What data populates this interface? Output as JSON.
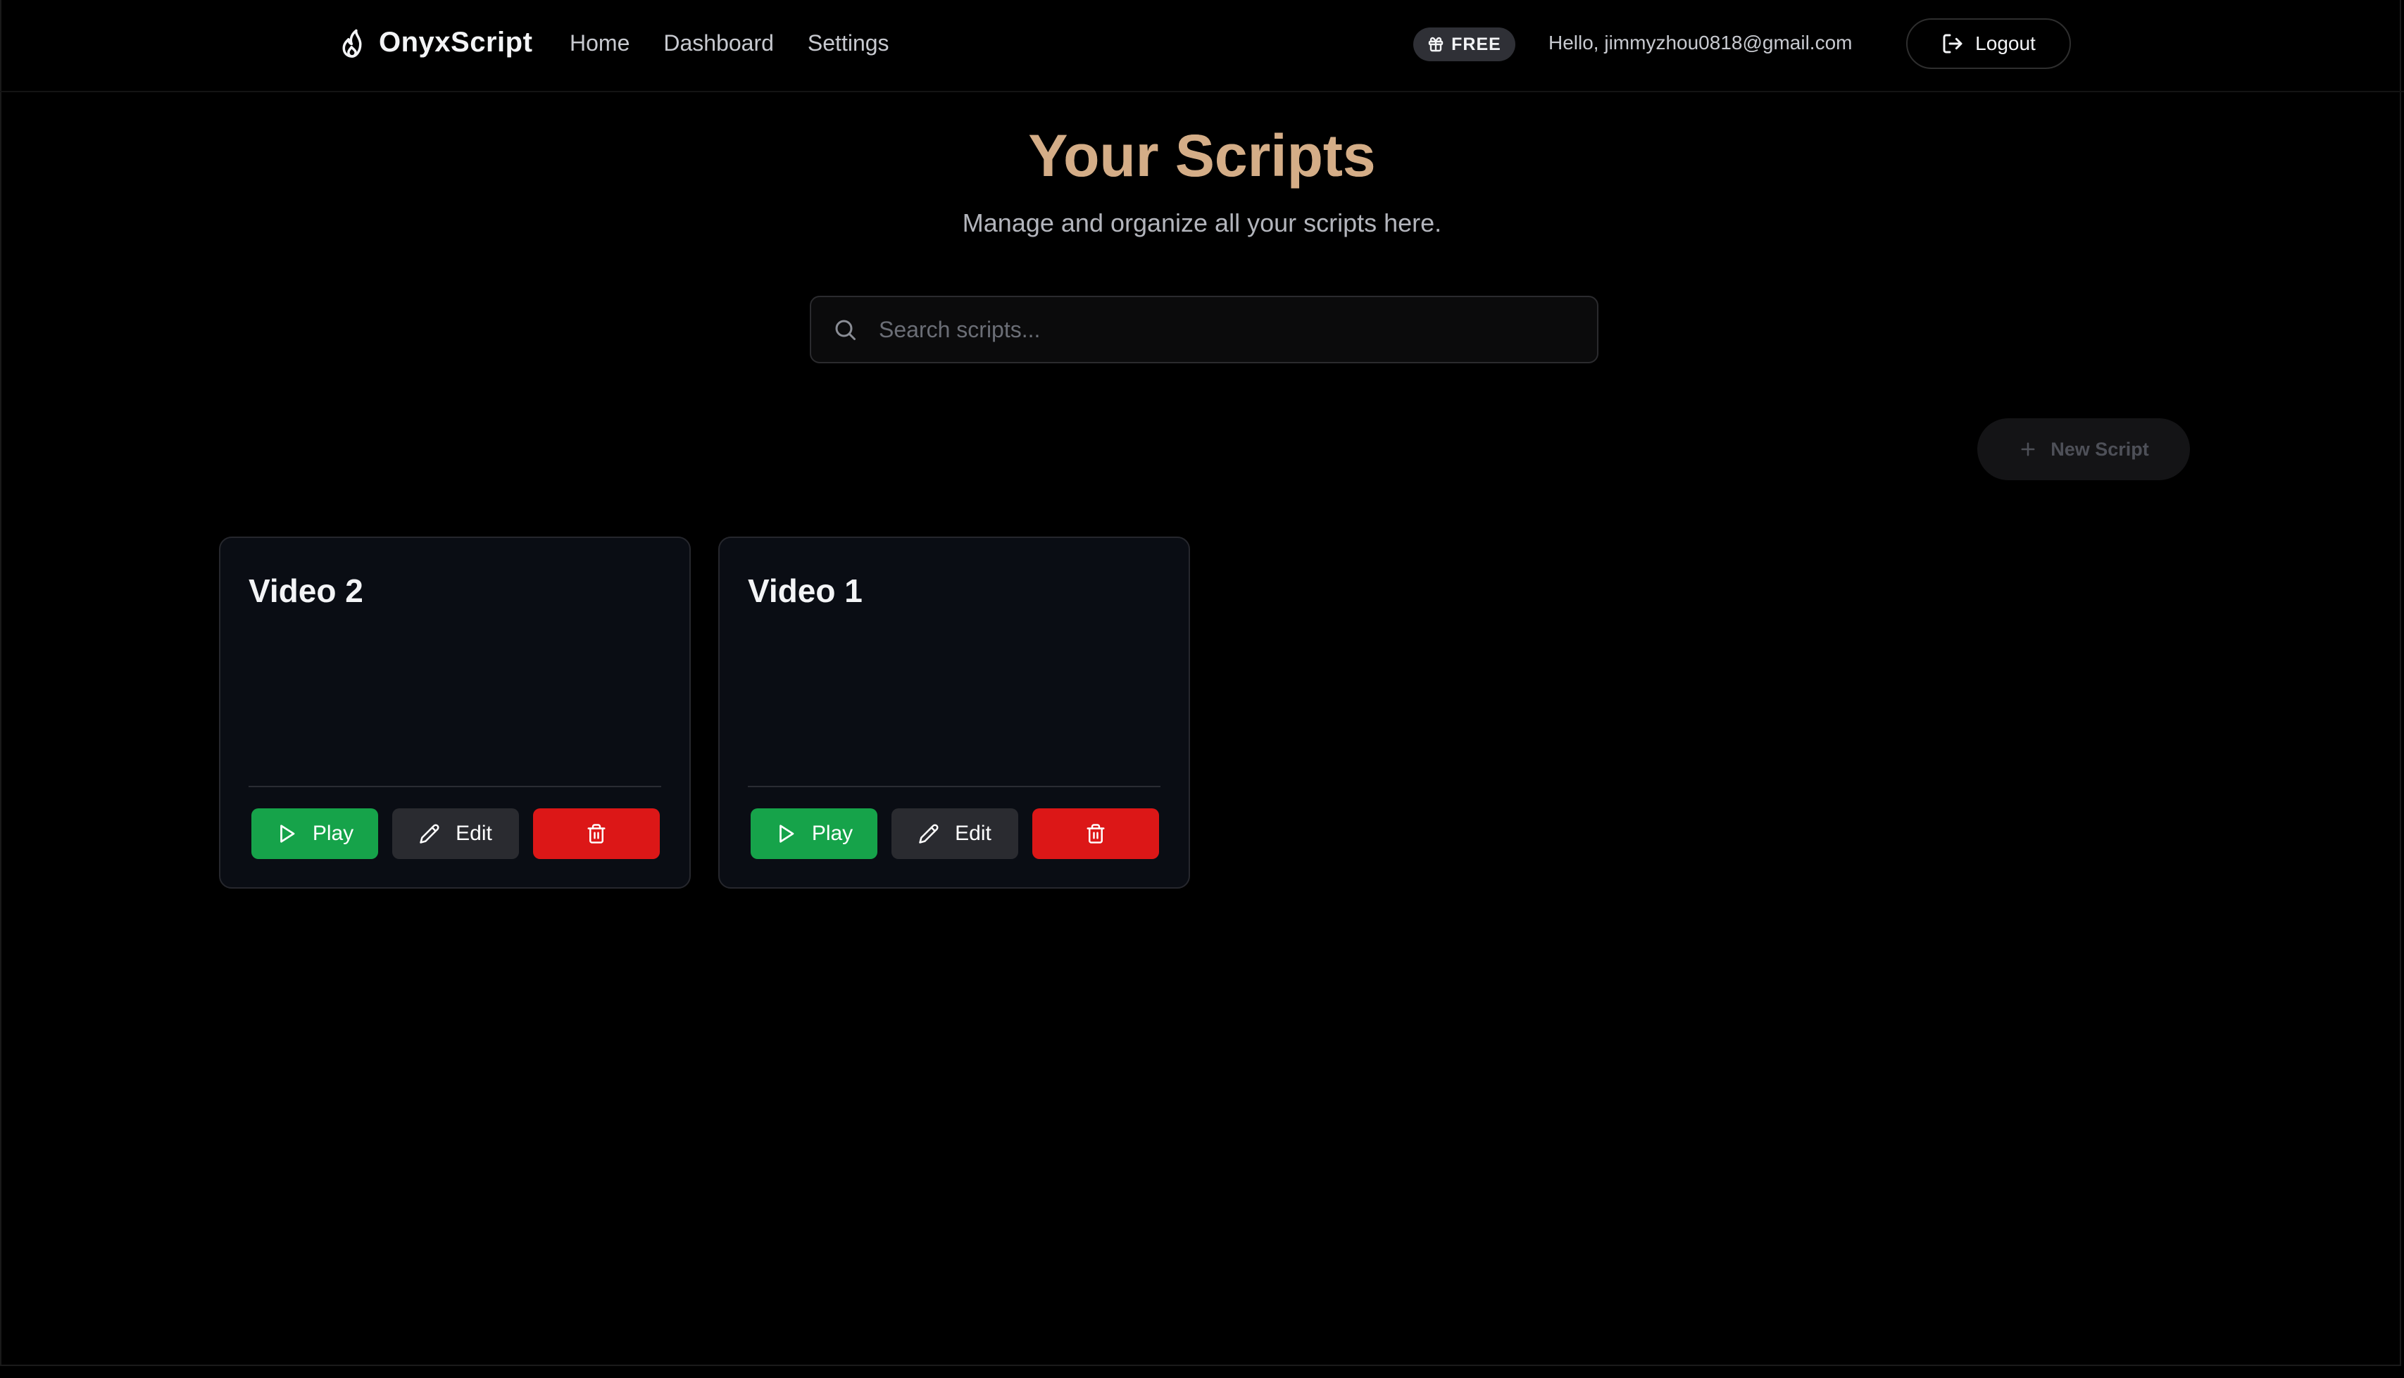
{
  "app": {
    "brand": "OnyxScript",
    "nav": [
      {
        "label": "Home"
      },
      {
        "label": "Dashboard"
      },
      {
        "label": "Settings"
      }
    ],
    "plan_badge": "FREE",
    "greeting": "Hello, jimmyzhou0818@gmail.com",
    "logout_label": "Logout"
  },
  "main": {
    "title": "Your Scripts",
    "subtitle": "Manage and organize all your scripts here.",
    "search": {
      "placeholder": "Search scripts...",
      "value": ""
    },
    "new_script_label": "New Script",
    "scripts": [
      {
        "title": "Video 2",
        "play_label": "Play",
        "edit_label": "Edit"
      },
      {
        "title": "Video 1",
        "play_label": "Play",
        "edit_label": "Edit"
      }
    ]
  },
  "colors": {
    "background": "#000000",
    "title_accent": "#d4ad87",
    "play": "#16a34a",
    "edit": "#2a2b30",
    "delete": "#dc1717",
    "card_bg": "#0a0d14"
  },
  "icons": {
    "logo": "flame-icon",
    "plan": "gift-icon",
    "logout": "logout-icon",
    "search": "search-icon",
    "new_script": "plus-icon",
    "play": "play-icon",
    "edit": "pencil-icon",
    "delete": "trash-icon"
  }
}
